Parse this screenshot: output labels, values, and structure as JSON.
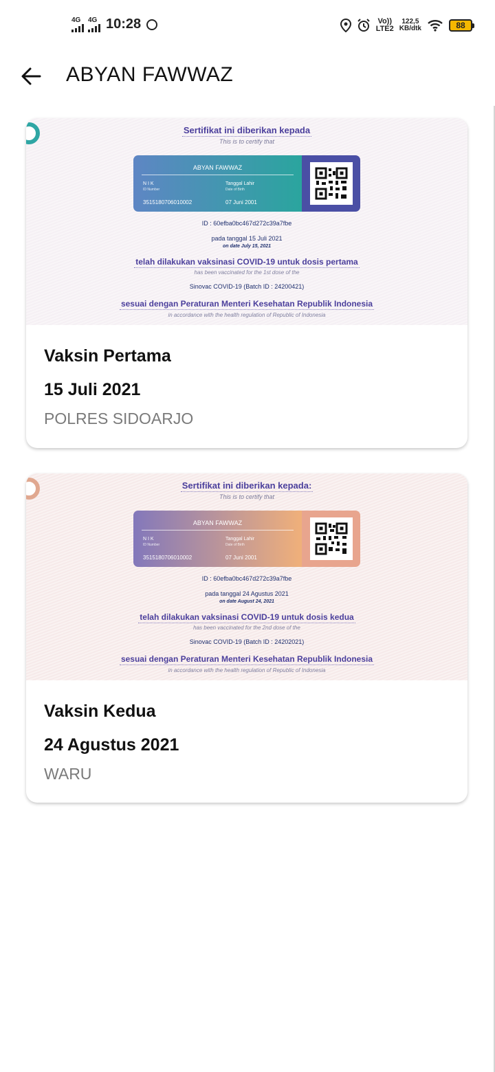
{
  "status_bar": {
    "network_1": "4G",
    "network_2": "4G",
    "time": "10:28",
    "volte_top": "Vo))",
    "volte_bottom": "LTE2",
    "speed_value": "122,5",
    "speed_unit": "KB/dtk",
    "battery": "88",
    "battery_color": "#f5b800",
    "icons": [
      "whatsapp-icon",
      "location-icon",
      "alarm-icon",
      "wifi-icon",
      "battery-icon"
    ]
  },
  "header": {
    "back_icon": "arrow-left-icon",
    "title": "ABYAN FAWWAZ"
  },
  "certificates": [
    {
      "heading": "Sertifikat ini diberikan kepada",
      "heading_en": "This is to certify that",
      "name": "ABYAN FAWWAZ",
      "nik_label": "N I K",
      "nik_label_en": "ID Number",
      "nik": "3515180706010002",
      "dob_label": "Tanggal Lahir",
      "dob_label_en": "Date of Birth",
      "dob": "07 Juni 2001",
      "cert_id": "ID : 60efba0bc467d272c39a7fbe",
      "date_line": "pada tanggal 15 Juli 2021",
      "date_line_en": "on date July 15, 2021",
      "vaccinated_line": "telah dilakukan vaksinasi COVID-19 untuk dosis pertama",
      "vaccinated_line_en": "has been vaccinated for the 1st dose of the",
      "batch": "Sinovac COVID-19 (Batch ID : 24200421)",
      "regulation": "sesuai dengan Peraturan Menteri Kesehatan Republik Indonesia",
      "regulation_en": "in accordance with the health regulation of Republic of Indonesia",
      "dose_title": "Vaksin Pertama",
      "dose_date": "15 Juli 2021",
      "location": "POLRES SIDOARJO",
      "accent": "#2aa59e"
    },
    {
      "heading": "Sertifikat ini diberikan kepada:",
      "heading_en": "This is to certify that",
      "name": "ABYAN FAWWAZ",
      "nik_label": "N I K",
      "nik_label_en": "ID Number",
      "nik": "3515180706010002",
      "dob_label": "Tanggal Lahir",
      "dob_label_en": "Date of Birth",
      "dob": "07 Juni 2001",
      "cert_id": "ID : 60efba0bc467d272c39a7fbe",
      "date_line": "pada tanggal 24 Agustus 2021",
      "date_line_en": "on date August 24, 2021",
      "vaccinated_line": "telah dilakukan vaksinasi COVID-19 untuk dosis kedua",
      "vaccinated_line_en": "has been vaccinated for the 2nd dose of the",
      "batch": "Sinovac COVID-19 (Batch ID : 24202021)",
      "regulation": "sesuai dengan Peraturan Menteri Kesehatan Republik Indonesia",
      "regulation_en": "in accordance with the health regulation of Republic of Indonesia",
      "dose_title": "Vaksin Kedua",
      "dose_date": "24 Agustus 2021",
      "location": "WARU",
      "accent": "#f0b07a"
    }
  ]
}
